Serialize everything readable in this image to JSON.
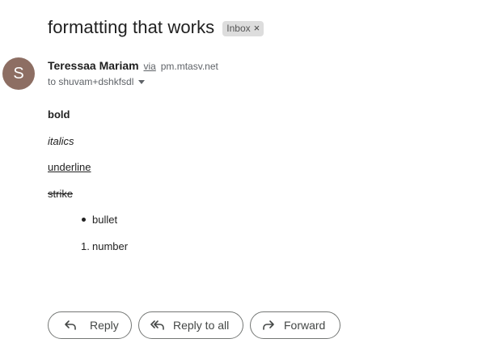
{
  "email": {
    "subject": "formatting that works",
    "label": "Inbox",
    "label_remove": "×",
    "avatar_letter": "S",
    "avatar_color": "#8d6e63",
    "sender_name": "Teressaa Mariam",
    "via": "via",
    "via_domain": "pm.mtasv.net",
    "to_line": "to shuvam+dshkfsdl"
  },
  "body": {
    "bold": "bold",
    "italics": "italics",
    "underline": "underline",
    "strike": "strike",
    "bullet_item": "bullet",
    "number_marker": "1.",
    "number_item": "number"
  },
  "actions": {
    "reply": "Reply",
    "reply_all": "Reply to all",
    "forward": "Forward"
  },
  "icons": {
    "reply": "reply-icon",
    "reply_all": "reply-all-icon",
    "forward": "forward-icon",
    "caret": "chevron-down-icon"
  }
}
